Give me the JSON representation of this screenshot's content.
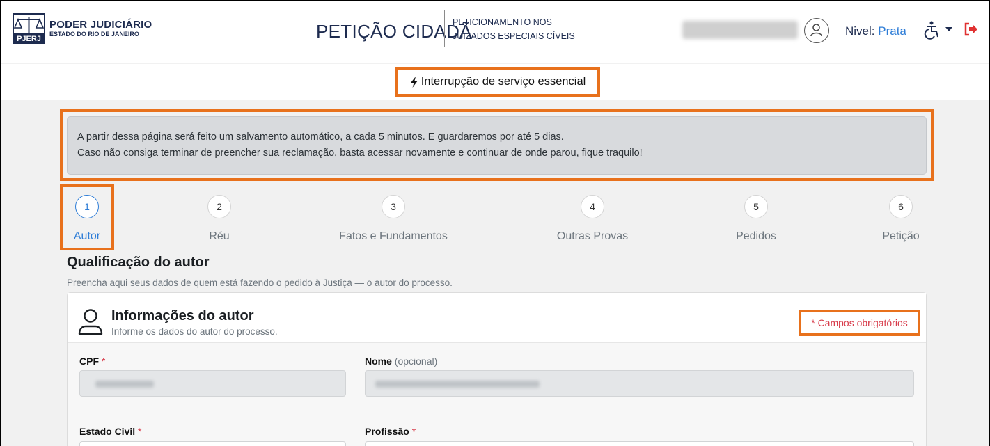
{
  "header": {
    "logo_title": "PODER JUDICIÁRIO",
    "logo_sub": "ESTADO DO RIO DE JANEIRO",
    "logo_mark": "PJERJ",
    "brand": "PETIÇÃO CIDADÃ",
    "brand_sub_1": "PETICIONAMENTO NOS",
    "brand_sub_2": "JUIZADOS ESPECIAIS CÍVEIS",
    "nivel_label": "Nivel:",
    "nivel_value": "Prata",
    "icons": [
      "user-circle-icon",
      "accessibility-icon",
      "logout-icon"
    ]
  },
  "alert": {
    "label": "Interrupção de serviço essencial",
    "icon": "lightning-icon"
  },
  "notice": {
    "line1": "A partir dessa página será feito um salvamento automático, a cada 5 minutos. E guardaremos por até 5 dias.",
    "line2": "Caso não consiga terminar de preencher sua reclamação, basta acessar novamente e continuar de onde parou, fique traquilo!"
  },
  "steps": [
    {
      "number": "1",
      "label": "Autor",
      "active": true
    },
    {
      "number": "2",
      "label": "Réu"
    },
    {
      "number": "3",
      "label": "Fatos e Fundamentos"
    },
    {
      "number": "4",
      "label": "Outras Provas"
    },
    {
      "number": "5",
      "label": "Pedidos"
    },
    {
      "number": "6",
      "label": "Petição"
    }
  ],
  "section": {
    "title": "Qualificação do autor",
    "subtitle": "Preencha aqui seus dados de quem está fazendo o pedido à Justiça — o autor do processo."
  },
  "card": {
    "title": "Informações do autor",
    "subtitle": "Informe os dados do autor do processo.",
    "required_note": "* Campos obrigatórios",
    "fields": {
      "cpf": "CPF",
      "nome": "Nome",
      "nome_opt": "(opcional)",
      "estado_civil": "Estado Civil",
      "profissao": "Profissão",
      "required_mark": "*"
    }
  },
  "colors": {
    "highlight": "#e8711c",
    "accent": "#2e7dd7",
    "required": "#d73a49",
    "logout": "#e03131"
  }
}
